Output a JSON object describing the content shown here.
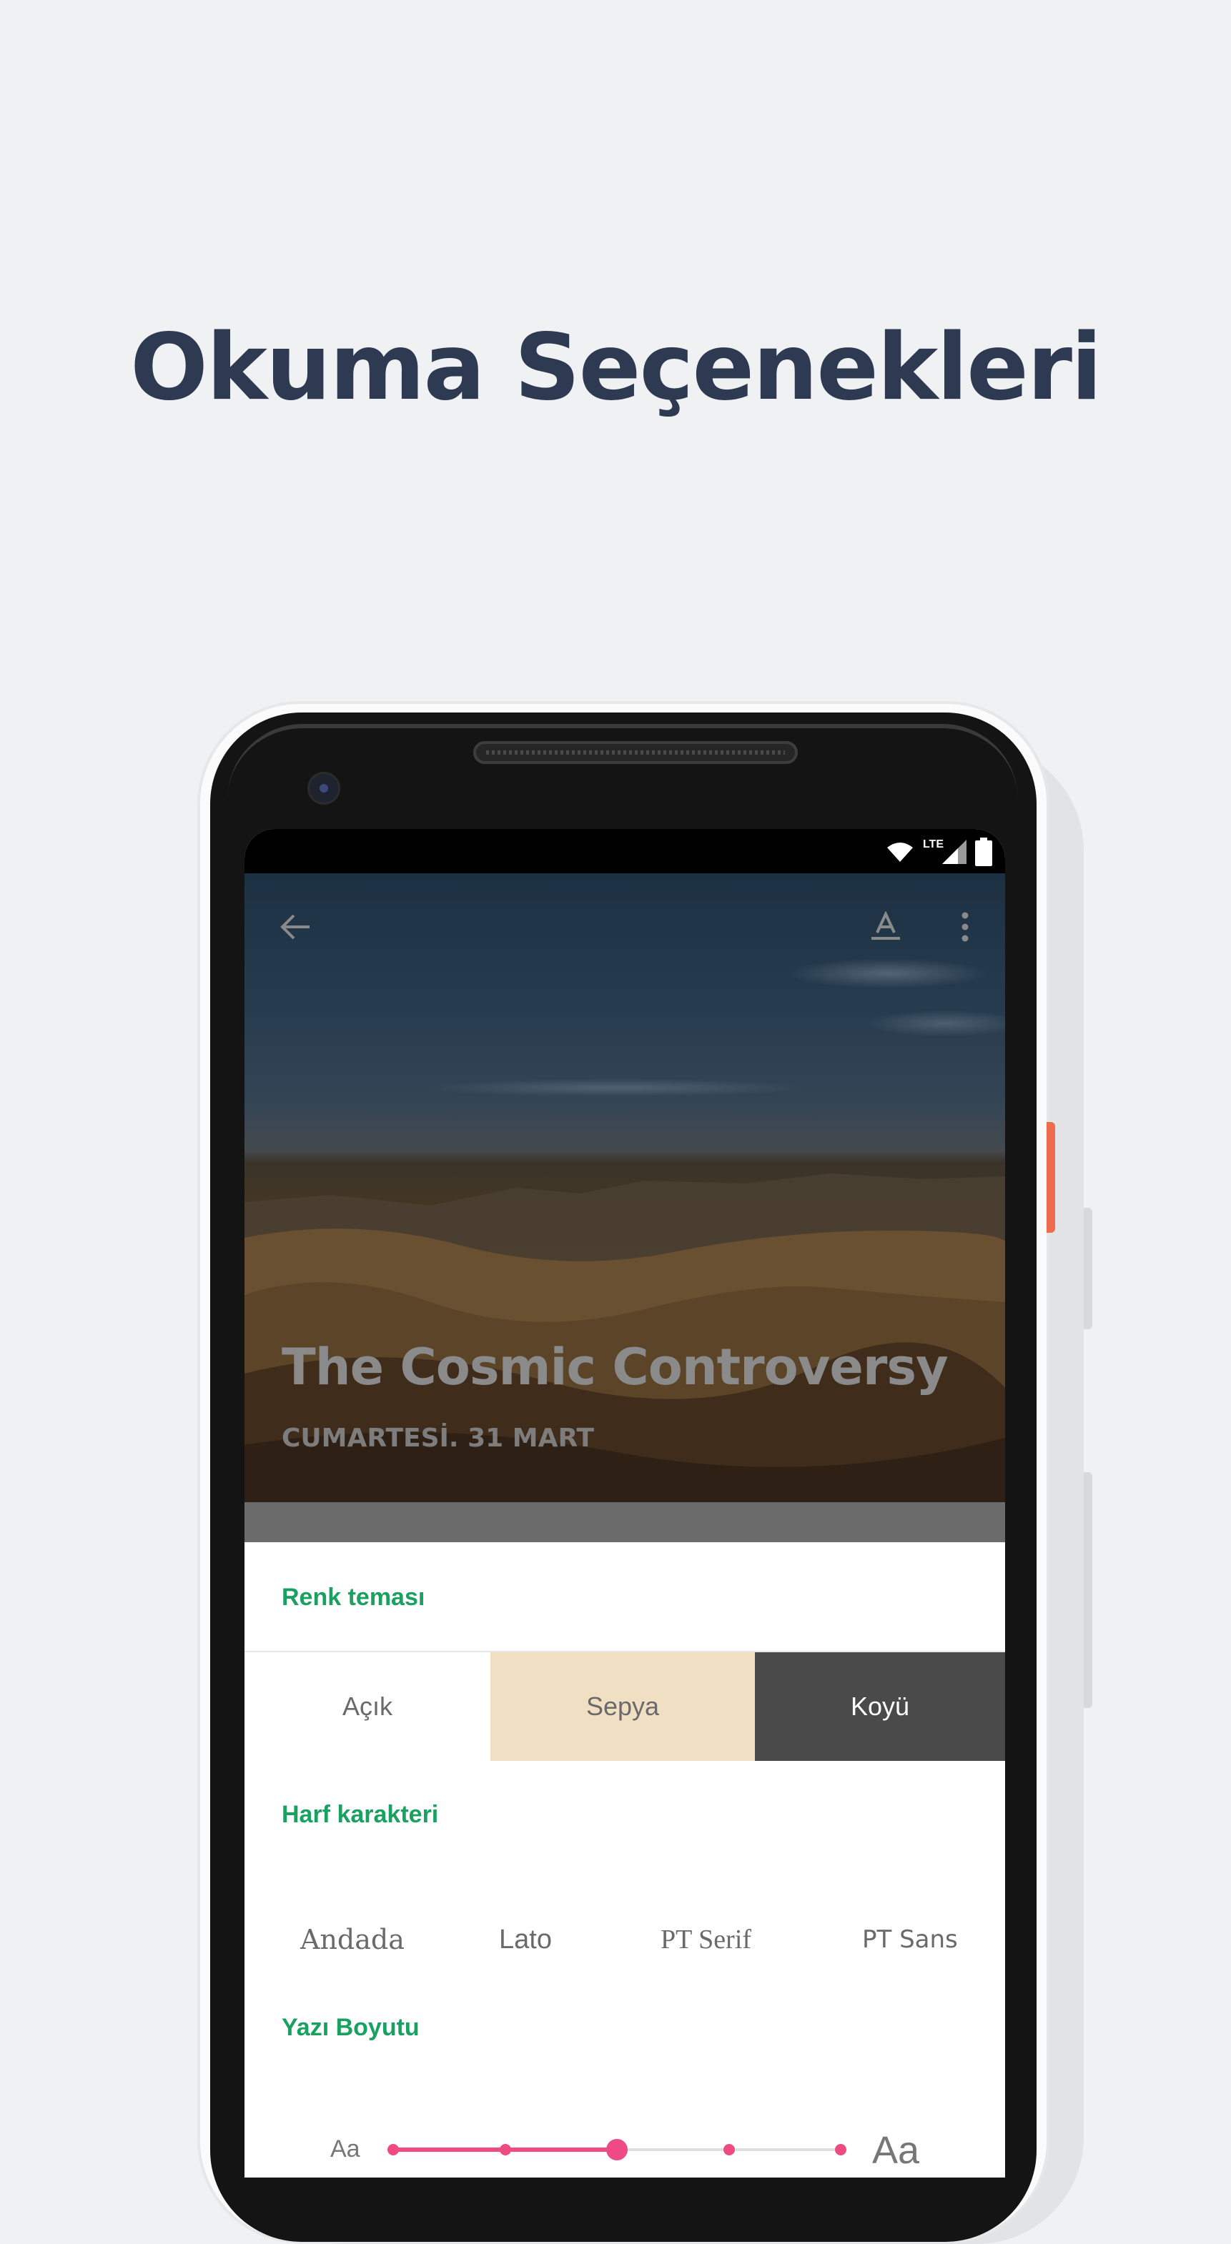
{
  "promo": {
    "headline": "Okuma Seçenekleri"
  },
  "status_bar": {
    "network_label": "LTE"
  },
  "article": {
    "title": "The Cosmic Controversy",
    "date": "CUMARTESİ. 31 MART"
  },
  "settings_sheet": {
    "color_theme": {
      "label": "Renk teması",
      "options": [
        {
          "label": "Açık",
          "bg": "#ffffff",
          "fg": "#6a6a6a"
        },
        {
          "label": "Sepya",
          "bg": "#f1dfc4",
          "fg": "#6a6a6a"
        },
        {
          "label": "Koyü",
          "bg": "#4a4a4a",
          "fg": "#ffffff"
        }
      ]
    },
    "typeface": {
      "label": "Harf karakteri",
      "options": [
        "Andada",
        "Lato",
        "PT Serif",
        "PT Sans"
      ]
    },
    "text_size": {
      "label": "Yazı Boyutu",
      "min_label": "Aa",
      "max_label": "Aa",
      "steps": 5,
      "selected_step": 3
    }
  },
  "colors": {
    "headline": "#2d3a52",
    "section_label": "#1aa060",
    "slider_accent": "#ee4b84",
    "phone_accent_button": "#ee6b4d"
  }
}
